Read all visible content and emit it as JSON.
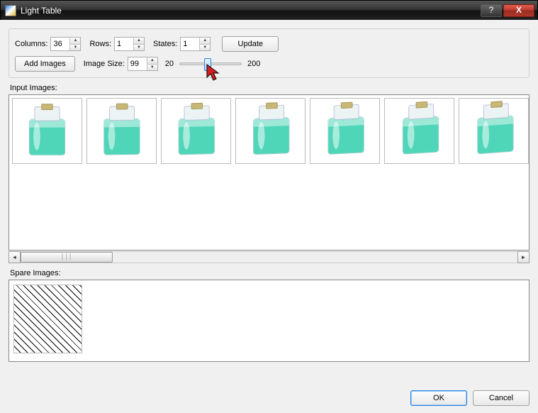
{
  "window": {
    "title": "Light Table"
  },
  "controls": {
    "columns_label": "Columns:",
    "columns_value": "36",
    "rows_label": "Rows:",
    "rows_value": "1",
    "states_label": "States:",
    "states_value": "1",
    "update_label": "Update",
    "add_images_label": "Add Images",
    "image_size_label": "Image Size:",
    "image_size_value": "99",
    "slider_min": "20",
    "slider_max": "200",
    "slider_percent": 44
  },
  "sections": {
    "input_images": "Input Images:",
    "spare_images": "Spare Images:"
  },
  "footer": {
    "ok": "OK",
    "cancel": "Cancel"
  },
  "thumbnails": [
    {
      "rotation": 0
    },
    {
      "rotation": 8
    },
    {
      "rotation": 16
    },
    {
      "rotation": 24
    },
    {
      "rotation": 32
    },
    {
      "rotation": 40
    },
    {
      "rotation": 48
    }
  ]
}
